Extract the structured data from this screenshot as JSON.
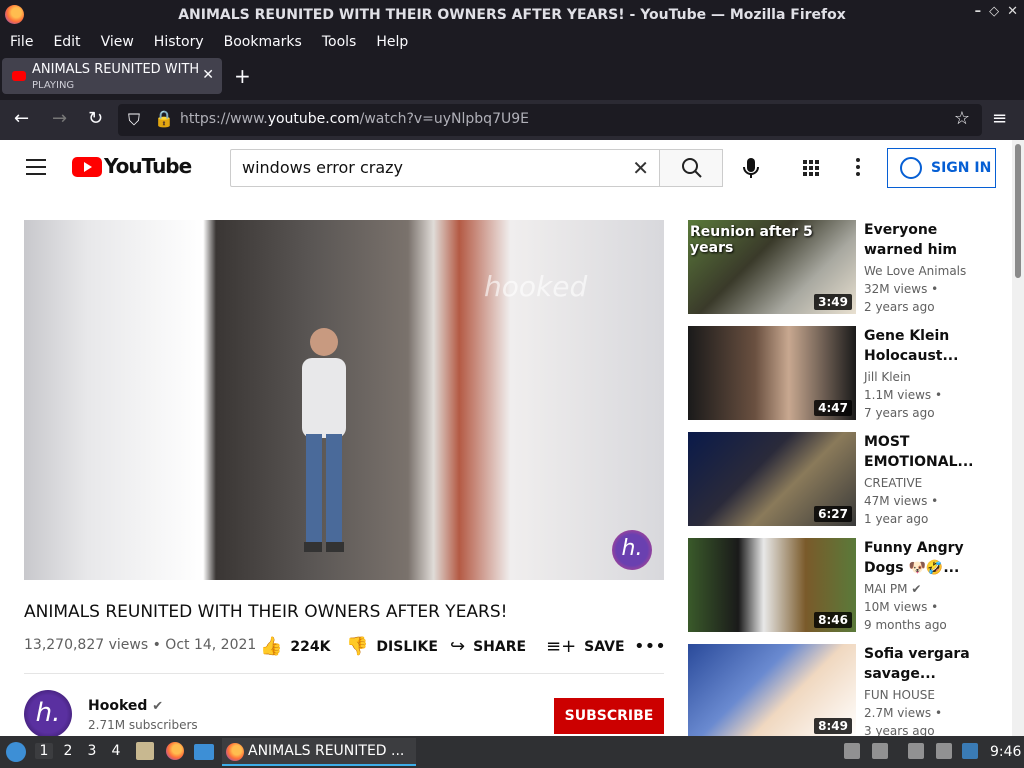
{
  "window": {
    "title": "ANIMALS REUNITED WITH THEIR OWNERS AFTER YEARS! - YouTube — Mozilla Firefox"
  },
  "menubar": {
    "items": [
      "File",
      "Edit",
      "View",
      "History",
      "Bookmarks",
      "Tools",
      "Help"
    ]
  },
  "tab": {
    "title": "ANIMALS REUNITED WITH THEIR OWNERS AFTER YEARS!",
    "status": "PLAYING"
  },
  "navbar": {
    "url_prefix": "https://www.",
    "url_domain": "youtube.com",
    "url_path": "/watch?v=uyNlpbq7U9E"
  },
  "youtube": {
    "logo_text": "YouTube",
    "search_value": "windows error crazy",
    "sign_in": "SIGN IN"
  },
  "video": {
    "title": "ANIMALS REUNITED WITH THEIR OWNERS AFTER YEARS!",
    "meta": "13,270,827 views • Oct 14, 2021",
    "likes": "224K",
    "dislike": "DISLIKE",
    "share": "SHARE",
    "save": "SAVE",
    "watermark": "hooked",
    "badge": "h."
  },
  "channel": {
    "name": "Hooked",
    "subscribers": "2.71M subscribers",
    "subscribe": "SUBSCRIBE",
    "avatar_letter": "h."
  },
  "recommendations": [
    {
      "title": "Everyone warned him to...",
      "channel": "We Love Animals",
      "views": "32M views •",
      "age": "2 years ago",
      "duration": "3:49",
      "overlay": "Reunion after 5 years"
    },
    {
      "title": "Gene Klein Holocaust...",
      "channel": "Jill Klein",
      "views": "1.1M views •",
      "age": "7 years ago",
      "duration": "4:47",
      "overlay": ""
    },
    {
      "title": "MOST EMOTIONAL...",
      "channel": "CREATIVE",
      "views": "47M views •",
      "age": "1 year ago",
      "duration": "6:27",
      "overlay": ""
    },
    {
      "title": "Funny Angry Dogs 🐶🤣...",
      "channel": "MAI PM",
      "views": "10M views •",
      "age": "9 months ago",
      "duration": "8:46",
      "overlay": ""
    },
    {
      "title": "Sofia vergara savage...",
      "channel": "FUN HOUSE",
      "views": "2.7M views •",
      "age": "3 years ago",
      "duration": "8:49",
      "overlay": ""
    }
  ],
  "taskbar": {
    "workspaces": [
      "1",
      "2",
      "3",
      "4"
    ],
    "task_label": "ANIMALS REUNITED ...",
    "clock": "9:46"
  }
}
